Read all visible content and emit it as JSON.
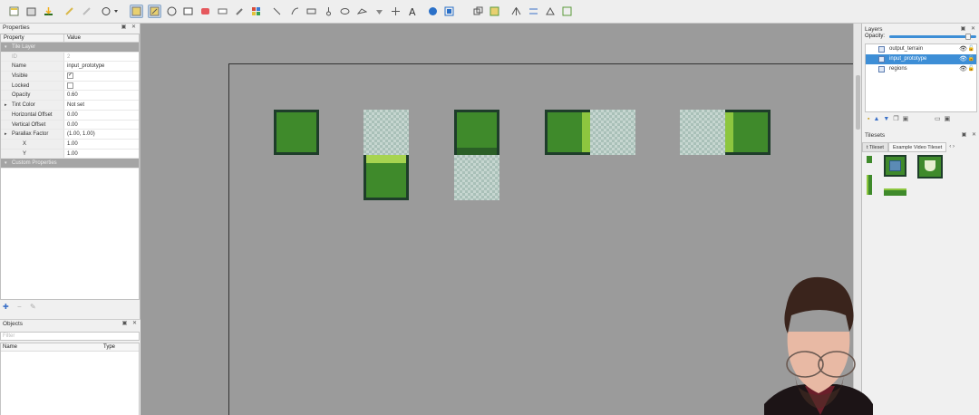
{
  "toolbar": {
    "icons": [
      "new-map-icon",
      "open-icon",
      "save-icon",
      "undo-icon",
      "redo-icon",
      "stamp-dropdown-icon",
      "select-icon",
      "stamp-brush-icon",
      "terrain-brush-icon",
      "bucket-fill-icon",
      "shape-fill-icon",
      "eraser-icon",
      "rect-select-icon",
      "magic-wand-icon",
      "select-same-icon",
      "select-objects-icon",
      "edit-polygons-icon",
      "insert-rect-icon",
      "insert-point-icon",
      "insert-ellipse-icon",
      "insert-polygon-icon",
      "insert-template-icon",
      "insert-text-icon",
      "random-mode-icon",
      "wang-fill-icon",
      "crop-icon",
      "flip-icon",
      "rotate-left-icon",
      "rotate-right-icon"
    ]
  },
  "properties": {
    "title": "Properties",
    "col_property": "Property",
    "col_value": "Value",
    "group_tile_layer": "Tile Layer",
    "group_custom": "Custom Properties",
    "rows": [
      {
        "k": "ID",
        "v": "2",
        "disabled": true
      },
      {
        "k": "Name",
        "v": "input_prototype"
      },
      {
        "k": "Visible",
        "v": "✓",
        "checkbox": true
      },
      {
        "k": "Locked",
        "v": "",
        "checkbox": true
      },
      {
        "k": "Opacity",
        "v": "0.60"
      },
      {
        "k": "Tint Color",
        "v": "Not set",
        "expand": true
      },
      {
        "k": "Horizontal Offset",
        "v": "0.00"
      },
      {
        "k": "Vertical Offset",
        "v": "0.00"
      },
      {
        "k": "Parallax Factor",
        "v": "(1.00, 1.00)",
        "expand": true
      },
      {
        "k": "X",
        "v": "1.00",
        "sub": true
      },
      {
        "k": "Y",
        "v": "1.00",
        "sub": true
      }
    ]
  },
  "objects": {
    "title": "Objects",
    "filter_placeholder": "Filter",
    "col_name": "Name",
    "col_type": "Type"
  },
  "layers": {
    "title": "Layers",
    "opacity_label": "Opacity:",
    "items": [
      {
        "name": "output_terrain",
        "selected": false
      },
      {
        "name": "input_prototype",
        "selected": true
      },
      {
        "name": "regions",
        "selected": false
      }
    ]
  },
  "tilesets": {
    "title": "Tilesets",
    "tabs": [
      "t Tileset",
      "Example Video Tileset"
    ]
  },
  "colors": {
    "accent": "#3d8ed6",
    "tile_green": "#3f8a2b",
    "tile_light": "#8dc63f",
    "tile_border": "#1e3d2a"
  }
}
